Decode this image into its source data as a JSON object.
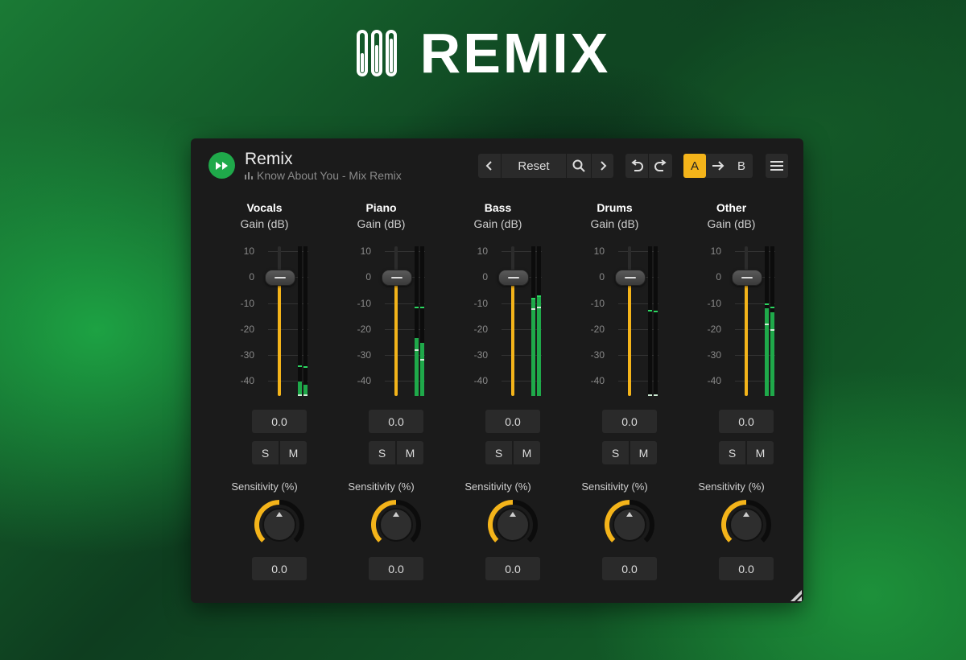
{
  "brand": {
    "name": "REMIX",
    "icon": "slider-bars-icon"
  },
  "plugin": {
    "title": "Remix",
    "subtitle": "Know About You - Mix Remix",
    "subtitle_icon": "bar-chart-icon",
    "logo_icon": "fast-forward-icon",
    "colors": {
      "accent": "#f4b41a",
      "brand": "#1fa94a",
      "panel": "#1b1b1b",
      "control": "#2a2a2a"
    }
  },
  "toolbar": {
    "prev_icon": "chevron-left-icon",
    "reset_label": "Reset",
    "search_icon": "search-icon",
    "next_icon": "chevron-right-icon",
    "undo_icon": "undo-icon",
    "redo_icon": "redo-icon",
    "a_label": "A",
    "arrow_icon": "arrow-right-icon",
    "b_label": "B",
    "menu_icon": "hamburger-menu-icon",
    "active_preset": "A"
  },
  "scale": {
    "ticks": [
      "10",
      "0",
      "-10",
      "-20",
      "-30",
      "-40"
    ],
    "min_db": -46,
    "max_db": 12
  },
  "common": {
    "gain_label": "Gain (dB)",
    "sensitivity_label": "Sensitivity (%)",
    "solo_label": "S",
    "mute_label": "M"
  },
  "channels": [
    {
      "name": "Vocals",
      "gain_value": "0.0",
      "sensitivity_value": "0.0",
      "gain_db": 0,
      "sensitivity_fraction": 0.5,
      "meter_l": {
        "level_db": -40.5,
        "peak_db": -34,
        "rms_db": -45.5
      },
      "meter_r": {
        "level_db": -41.5,
        "peak_db": -34.5,
        "rms_db": -45.5
      }
    },
    {
      "name": "Piano",
      "gain_value": "0.0",
      "sensitivity_value": "0.0",
      "gain_db": 0,
      "sensitivity_fraction": 0.5,
      "meter_l": {
        "level_db": -23.5,
        "peak_db": -11.5,
        "rms_db": -28
      },
      "meter_r": {
        "level_db": -25.5,
        "peak_db": -11.5,
        "rms_db": -31.5
      }
    },
    {
      "name": "Bass",
      "gain_value": "0.0",
      "sensitivity_value": "0.0",
      "gain_db": 0,
      "sensitivity_fraction": 0.5,
      "meter_l": {
        "level_db": -8,
        "peak_db": -8,
        "rms_db": -12
      },
      "meter_r": {
        "level_db": -7,
        "peak_db": -7,
        "rms_db": -11.5
      }
    },
    {
      "name": "Drums",
      "gain_value": "0.0",
      "sensitivity_value": "0.0",
      "gain_db": 0,
      "sensitivity_fraction": 0.5,
      "meter_l": {
        "level_db": -46,
        "peak_db": -12.5,
        "rms_db": -45.5
      },
      "meter_r": {
        "level_db": -46,
        "peak_db": -13,
        "rms_db": -45.5
      }
    },
    {
      "name": "Other",
      "gain_value": "0.0",
      "sensitivity_value": "0.0",
      "gain_db": 0,
      "sensitivity_fraction": 0.5,
      "meter_l": {
        "level_db": -12,
        "peak_db": -10,
        "rms_db": -18
      },
      "meter_r": {
        "level_db": -13.5,
        "peak_db": -11.5,
        "rms_db": -20
      }
    }
  ]
}
